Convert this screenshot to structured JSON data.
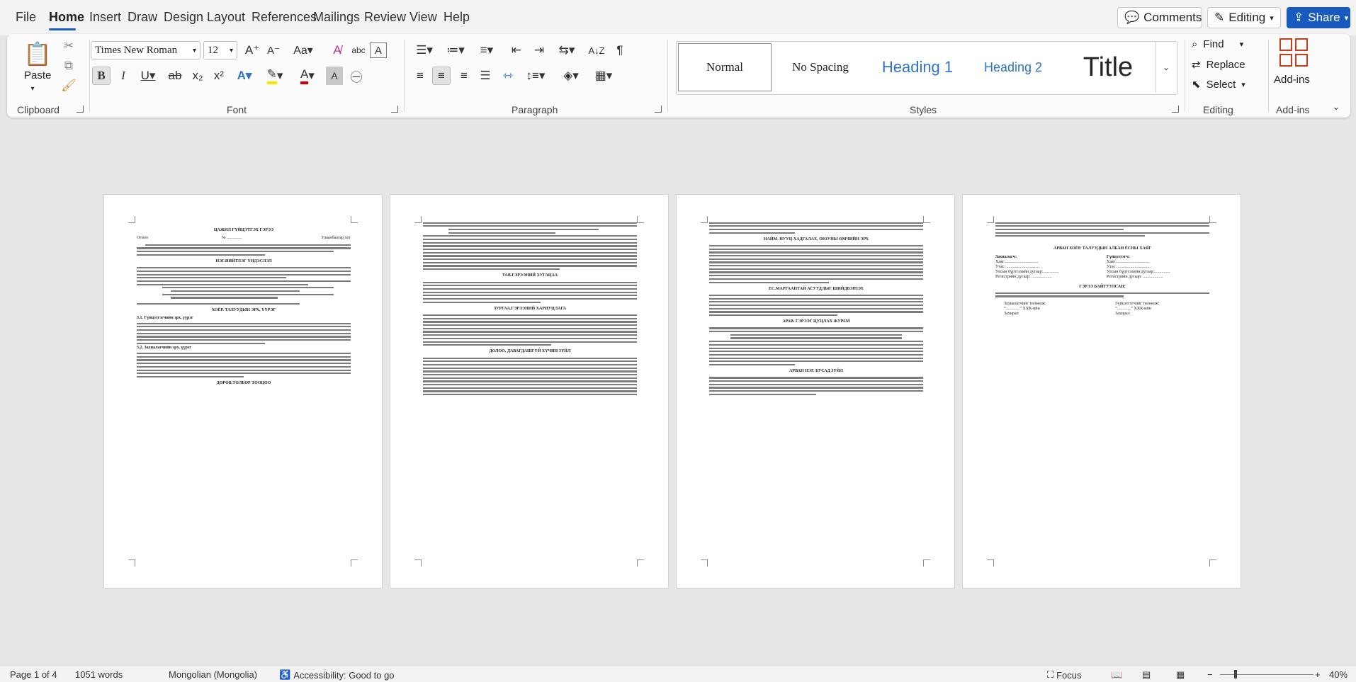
{
  "menu": {
    "tabs": [
      "File",
      "Home",
      "Insert",
      "Draw",
      "Design",
      "Layout",
      "References",
      "Mailings",
      "Review",
      "View",
      "Help"
    ],
    "active": "Home",
    "comments_label": "Comments",
    "editing_label": "Editing",
    "share_label": "Share"
  },
  "ribbon": {
    "clipboard": {
      "paste_label": "Paste",
      "group_label": "Clipboard"
    },
    "font": {
      "font_name": "Times New Roman",
      "font_size": "12",
      "group_label": "Font"
    },
    "paragraph": {
      "group_label": "Paragraph"
    },
    "styles": {
      "items": [
        "Normal",
        "No Spacing",
        "Heading 1",
        "Heading 2",
        "Title"
      ],
      "group_label": "Styles"
    },
    "editing": {
      "find_label": "Find",
      "replace_label": "Replace",
      "select_label": "Select",
      "group_label": "Editing"
    },
    "addins": {
      "label": "Add-ins",
      "group_label": "Add-ins"
    }
  },
  "pages": [
    {
      "heading": "ЦАЖИЛ ГҮЙЦЭТГЭХ ГЭРЭЭ",
      "place_left": "Огноо",
      "place_mid": "№ ..............",
      "place_right": "Улаанбаатар хот",
      "sections": [
        "НЭГ.НИЙТЛЭГ ҮНДЭСЛЭЛ",
        "ХОЁР. ТАЛУУДЫН ЭРХ, ҮҮРЭГ",
        "ДӨРӨВ.ТӨЛБӨР ТООЦОО"
      ],
      "sub_1": "3.1. Гүйцэтгэгчийн эрх, үүрэг",
      "sub_2": "3.2. Захиалагчийн эрх, үүрэг"
    },
    {
      "sections": [
        "ТАВ.ГЭРЭЭНИЙ ХУГАЦАА",
        "ЗУРГАА.ГЭРЭЭНИЙ ХАРИУЦЛАГА",
        "ДОЛОО. ДАВАГДАШГҮЙ ХҮЧИН ЗҮЙЛ"
      ]
    },
    {
      "sections": [
        "НАЙМ. НУУЦ ХАДГАЛАХ, ОЮУНЫ ӨМЧИЙН ЭРХ",
        "ЕС.МАРГААНТАЙ АСУУДЛЫГ ШИЙДВЭРЛЭХ",
        "АРАВ. ГЭРЭЭГ ЦУЦЛАХ ЖУРАМ",
        "АРВАН НЭГ. БУСАД ЗҮЙЛ"
      ]
    },
    {
      "sections": [
        "АРВАН ХОЁР. ТАЛУУДЫН АЛБАН ЁСНЫ ХАЯГ",
        "ГЭРЭЭ БАЙГУУЛСАН:"
      ],
      "col_left": "Захиалагч:",
      "col_right": "Гүйцэтгэгч:",
      "address_rows": [
        "Хаяг:...............................",
        "Утас: ...............................",
        "Улсын бүртгэлийн дугаар:...............",
        "Регистрийн дугаар: ..................."
      ],
      "sign_left": [
        "Захиалагчийг төлөөлж:",
        "“.............” ХХК-ийн",
        "Захирал"
      ],
      "sign_right": [
        "Гүйцэтгэгчийг төлөөлж:",
        "“.............” ХХК-ийн",
        "Захирал"
      ]
    }
  ],
  "status": {
    "page": "Page 1 of 4",
    "words": "1051 words",
    "language": "Mongolian (Mongolia)",
    "accessibility": "Accessibility: Good to go",
    "focus": "Focus",
    "zoom": "40%"
  }
}
